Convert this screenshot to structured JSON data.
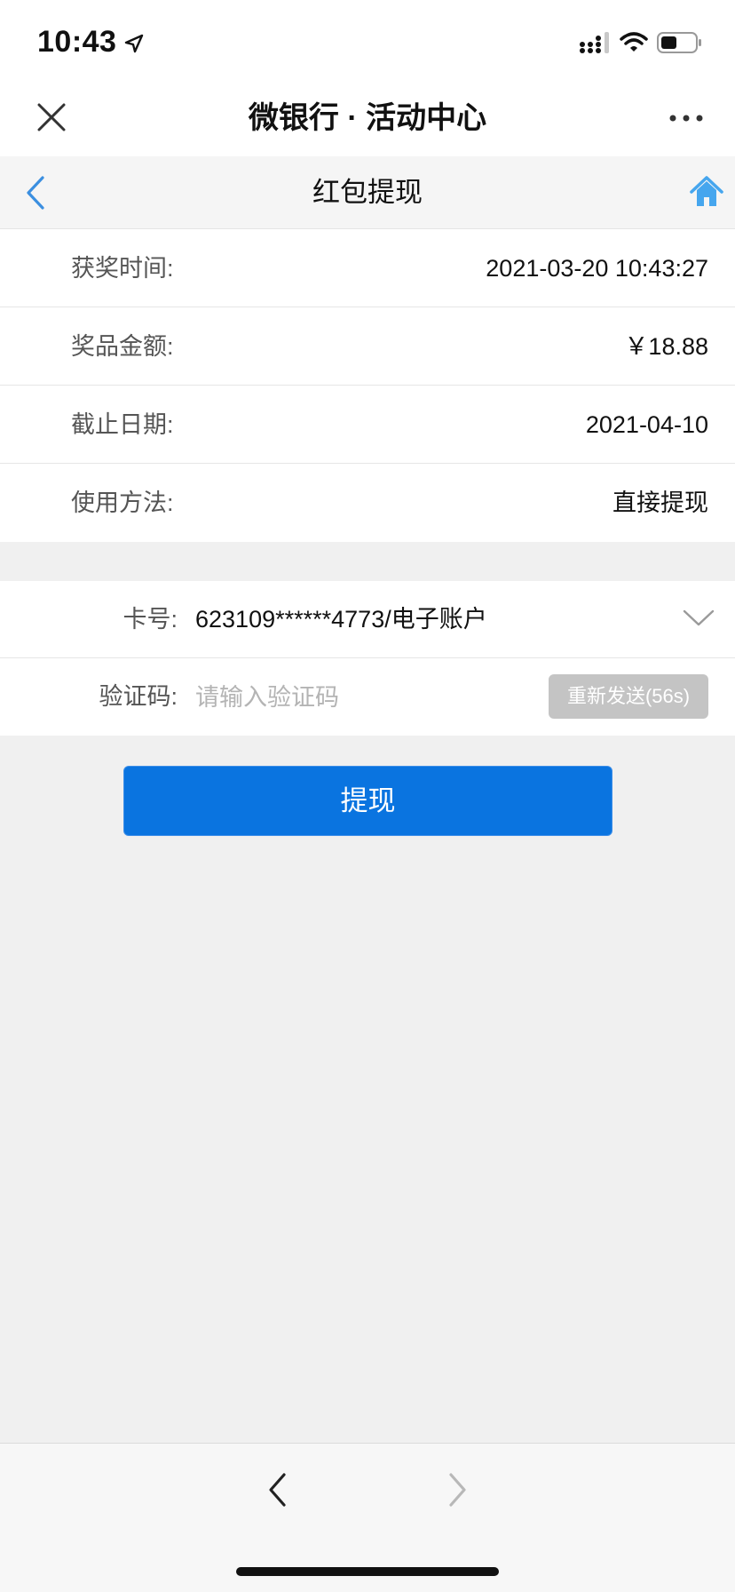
{
  "status_bar": {
    "time": "10:43",
    "icons": [
      "location-arrow-icon",
      "cellular-signal-icon",
      "wifi-icon",
      "battery-icon"
    ]
  },
  "nav_bar": {
    "title": "微银行 · 活动中心",
    "close_icon": "close-icon",
    "more_icon": "more-icon"
  },
  "sub_header": {
    "title": "红包提现",
    "back_icon": "chevron-left-icon",
    "home_icon": "home-icon",
    "accent_color": "#3b8fe0",
    "home_color": "#46a6ee"
  },
  "info": {
    "rows": [
      {
        "label": "获奖时间:",
        "value": "2021-03-20 10:43:27"
      },
      {
        "label": "奖品金额:",
        "value": "￥18.88"
      },
      {
        "label": "截止日期:",
        "value": "2021-04-10"
      },
      {
        "label": "使用方法:",
        "value": "直接提现"
      }
    ]
  },
  "form": {
    "card": {
      "label": "卡号:",
      "value": "623109******4773/电子账户",
      "icon": "chevron-down-icon"
    },
    "code": {
      "label": "验证码:",
      "placeholder": "请输入验证码",
      "value": "",
      "resend_label": "重新发送(56s)"
    }
  },
  "submit_label": "提现",
  "colors": {
    "primary": "#0a74e0",
    "disabled_button": "#c4c4c4",
    "background": "#f0f0f0"
  },
  "bottom_bar": {
    "back_icon": "chevron-left-icon",
    "forward_icon": "chevron-right-icon"
  }
}
